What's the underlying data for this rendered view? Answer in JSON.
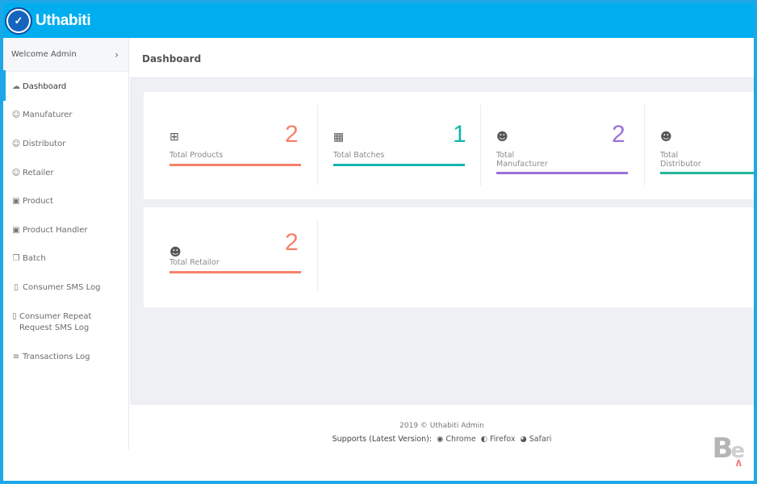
{
  "app": {
    "brand": "Uthabiti"
  },
  "sidebar": {
    "welcome": "Welcome Admin",
    "items": [
      {
        "label": "Dashboard",
        "icon": "cloud-icon"
      },
      {
        "label": "Manufaturer",
        "icon": "user-icon"
      },
      {
        "label": "Distributor",
        "icon": "user-icon"
      },
      {
        "label": "Retailer",
        "icon": "user-icon"
      },
      {
        "label": "Product",
        "icon": "box-icon"
      },
      {
        "label": "Product Handler",
        "icon": "box-icon"
      },
      {
        "label": "Batch",
        "icon": "copy-icon"
      },
      {
        "label": "Consumer SMS Log",
        "icon": "phone-icon"
      },
      {
        "label": "Consumer Repeat Request SMS Log",
        "icon": "phone-icon"
      },
      {
        "label": "Transactions Log",
        "icon": "list-icon"
      }
    ]
  },
  "header": {
    "title": "Dashboard"
  },
  "stats": [
    {
      "label": "Total Products",
      "value": "2",
      "color": "#f4826a",
      "icon": "plus-square-icon"
    },
    {
      "label": "Total Batches",
      "value": "1",
      "color": "#15b5b0",
      "icon": "cubes-icon"
    },
    {
      "label": "Total Manufacturer",
      "value": "2",
      "color": "#9b71d9",
      "icon": "users-icon"
    },
    {
      "label": "Total Distributor",
      "value": "",
      "color": "#23b89a",
      "icon": "users-icon"
    },
    {
      "label": "Total Retailor",
      "value": "2",
      "color": "#f4826a",
      "icon": "users-icon"
    }
  ],
  "footer": {
    "copyright": "2019 © Uthabiti Admin",
    "supports": "Supports (Latest Version):",
    "browsers": [
      "Chrome",
      "Firefox",
      "Safari"
    ]
  }
}
